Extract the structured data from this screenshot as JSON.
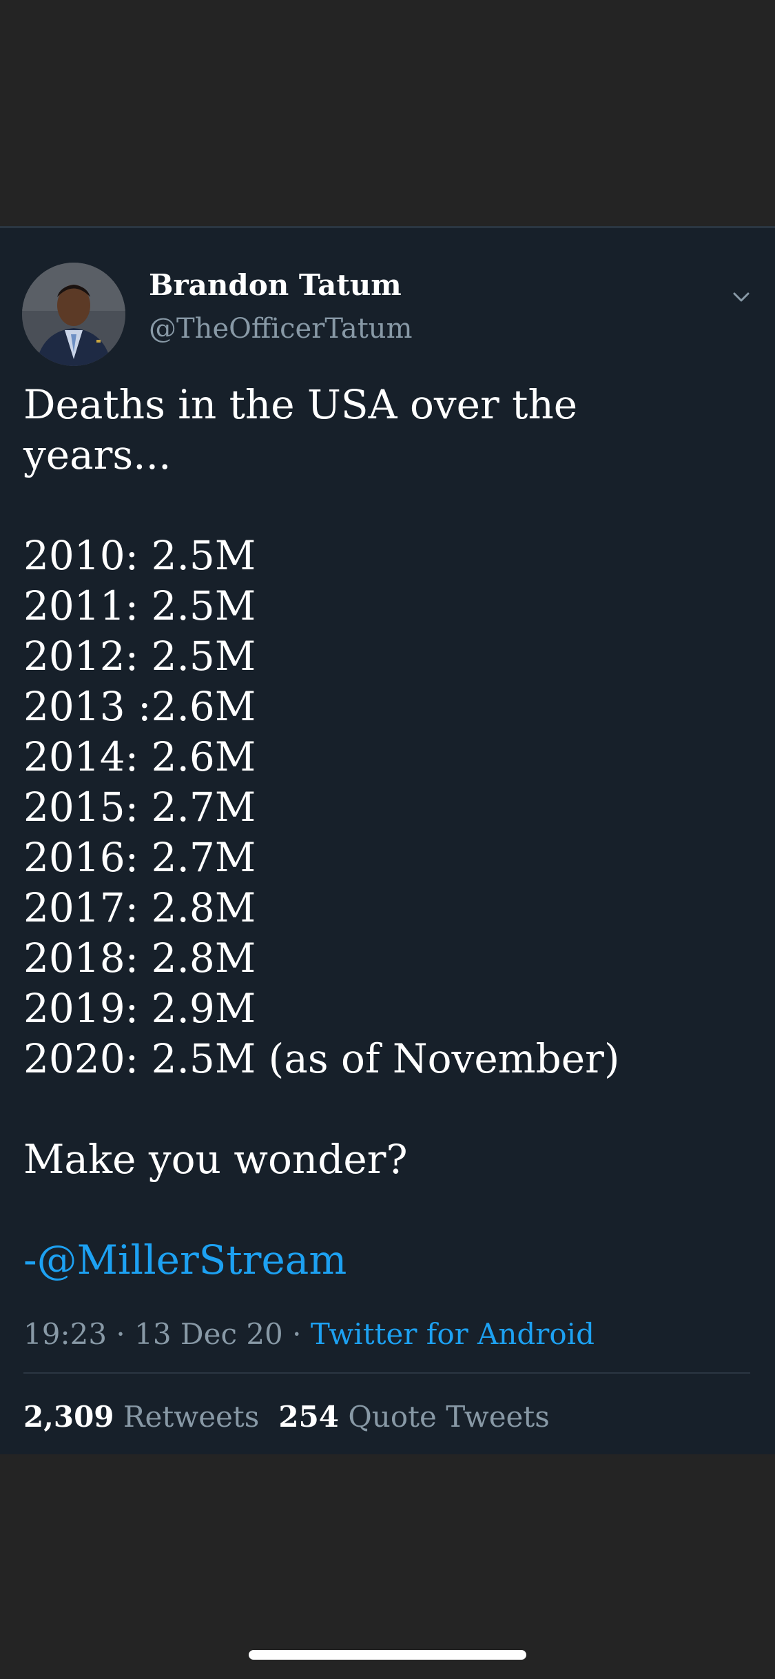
{
  "tweet": {
    "author_name": "Brandon Tatum",
    "author_handle": "@TheOfficerTatum",
    "intro_line1": "Deaths in the USA over the",
    "intro_line2": "years...",
    "year_lines": [
      "2010: 2.5M",
      "2011: 2.5M",
      "2012: 2.5M",
      "2013 :2.6M",
      "2014: 2.6M",
      "2015: 2.7M",
      "2016: 2.7M",
      "2017: 2.8M",
      "2018: 2.8M",
      "2019: 2.9M",
      "2020: 2.5M (as of November)"
    ],
    "question": "Make you wonder?",
    "credit": "-@MillerStream",
    "time": "19:23",
    "date": "13 Dec 20",
    "separator": "·",
    "source": "Twitter for Android",
    "retweet_count": "2,309",
    "retweet_label": "Retweets",
    "quote_count": "254",
    "quote_label": "Quote Tweets"
  },
  "icons": {
    "avatar": "profile-photo",
    "menu": "chevron-down-icon"
  },
  "colors": {
    "card_background": "#17202a",
    "outer_background": "#242424",
    "link": "#1da1f2",
    "muted_text": "#8899a6"
  }
}
